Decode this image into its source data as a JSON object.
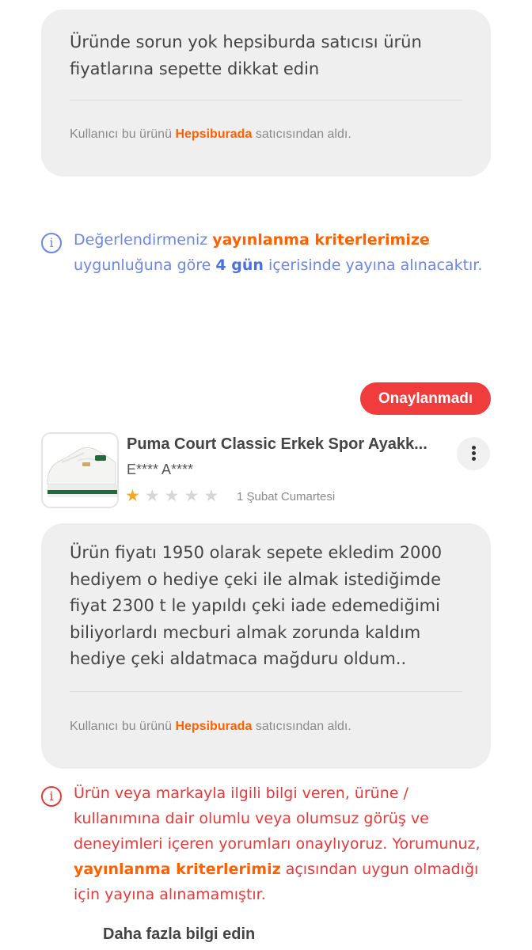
{
  "first_review": {
    "text": "Üründe sorun yok hepsiburda satıcısı ürün fiyatlarına sepette dikkat edin",
    "seller_prefix": "Kullanıcı bu ürünü",
    "seller_name": "Hepsiburada",
    "seller_suffix": "satıcısından aldı."
  },
  "pending_notice": {
    "icon": "info-icon",
    "part1": "Değerlendirmeniz",
    "link": "yayınlanma kriterlerimize",
    "part2": "uygunluğuna göre",
    "days": "4 gün",
    "part3": "içerisinde yayına alınacaktır."
  },
  "second_review": {
    "status_badge": "Onaylanmadı",
    "product_title": "Puma Court Classic Erkek Spor Ayakk...",
    "reviewer": "E**** A****",
    "rating": 1,
    "rating_max": 5,
    "date": "1 Şubat Cumartesi",
    "menu_icon": "more-vertical-icon",
    "text": "Ürün fiyatı 1950 olarak sepete ekledim 2000 hediyem o hediye çeki ile almak istediğimde fiyat 2300 t le yapıldı çeki iade edemediğimi biliyorlardı mecburi almak zorunda kaldım hediye çeki aldatmaca mağduru oldum..",
    "seller_prefix": "Kullanıcı bu ürünü",
    "seller_name": "Hepsiburada",
    "seller_suffix": "satıcısından aldı."
  },
  "rejection_notice": {
    "icon": "info-icon",
    "part1": "Ürün veya markayla ilgili bilgi veren, ürüne / kullanımına dair olumlu veya olumsuz görüş ve deneyimleri içeren yorumları onaylıyoruz. Yorumunuz,",
    "link": "yayınlanma kriterlerimiz",
    "part2": "açısından uygun olmadığı için yayına alınamamıştır.",
    "more_link": "Daha fazla bilgi edin"
  },
  "colors": {
    "accent_orange": "#ff6000",
    "info_blue": "#6b86e6",
    "error_red": "#e63a3a",
    "badge_red": "#f03c3c",
    "star_filled": "#f5a623"
  }
}
